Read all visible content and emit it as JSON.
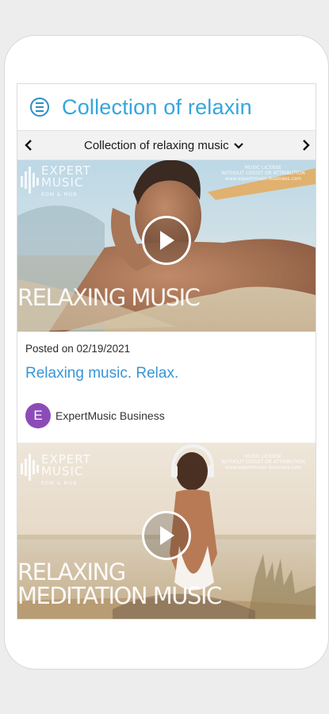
{
  "header": {
    "title": "Collection of relaxin",
    "menu_icon": "menu-circle-icon"
  },
  "subnav": {
    "title": "Collection of relaxing music",
    "prev_icon": "chevron-left-icon",
    "next_icon": "chevron-right-icon",
    "dropdown_icon": "chevron-down-icon"
  },
  "posts": [
    {
      "thumbnail": {
        "logo": {
          "line1": "EXPERT",
          "line2": "MUSIC",
          "sub": "RDM & MGB"
        },
        "corner_text": [
          "MUSIC LICENSE",
          "WITHOUT CREDIT OR ATTRIBUTION",
          "www.expertmusic-business.com"
        ],
        "overlay": [
          "RELAXING MUSIC"
        ]
      },
      "posted": "Posted on 02/19/2021",
      "title": "Relaxing music. Relax.",
      "author": {
        "initial": "E",
        "name": "ExpertMusic Business"
      }
    },
    {
      "thumbnail": {
        "logo": {
          "line1": "EXPERT",
          "line2": "MUSIC",
          "sub": "RDM & MGB"
        },
        "corner_text": [
          "MUSIC LICENSE",
          "WITHOUT CREDIT OR ATTRIBUTION",
          "www.expertmusic-business.com"
        ],
        "overlay": [
          "RELAXING",
          "MEDITATION MUSIC"
        ]
      }
    }
  ],
  "colors": {
    "accent": "#34a6dc",
    "link": "#3796d6",
    "avatar": "#8b4cb8"
  }
}
